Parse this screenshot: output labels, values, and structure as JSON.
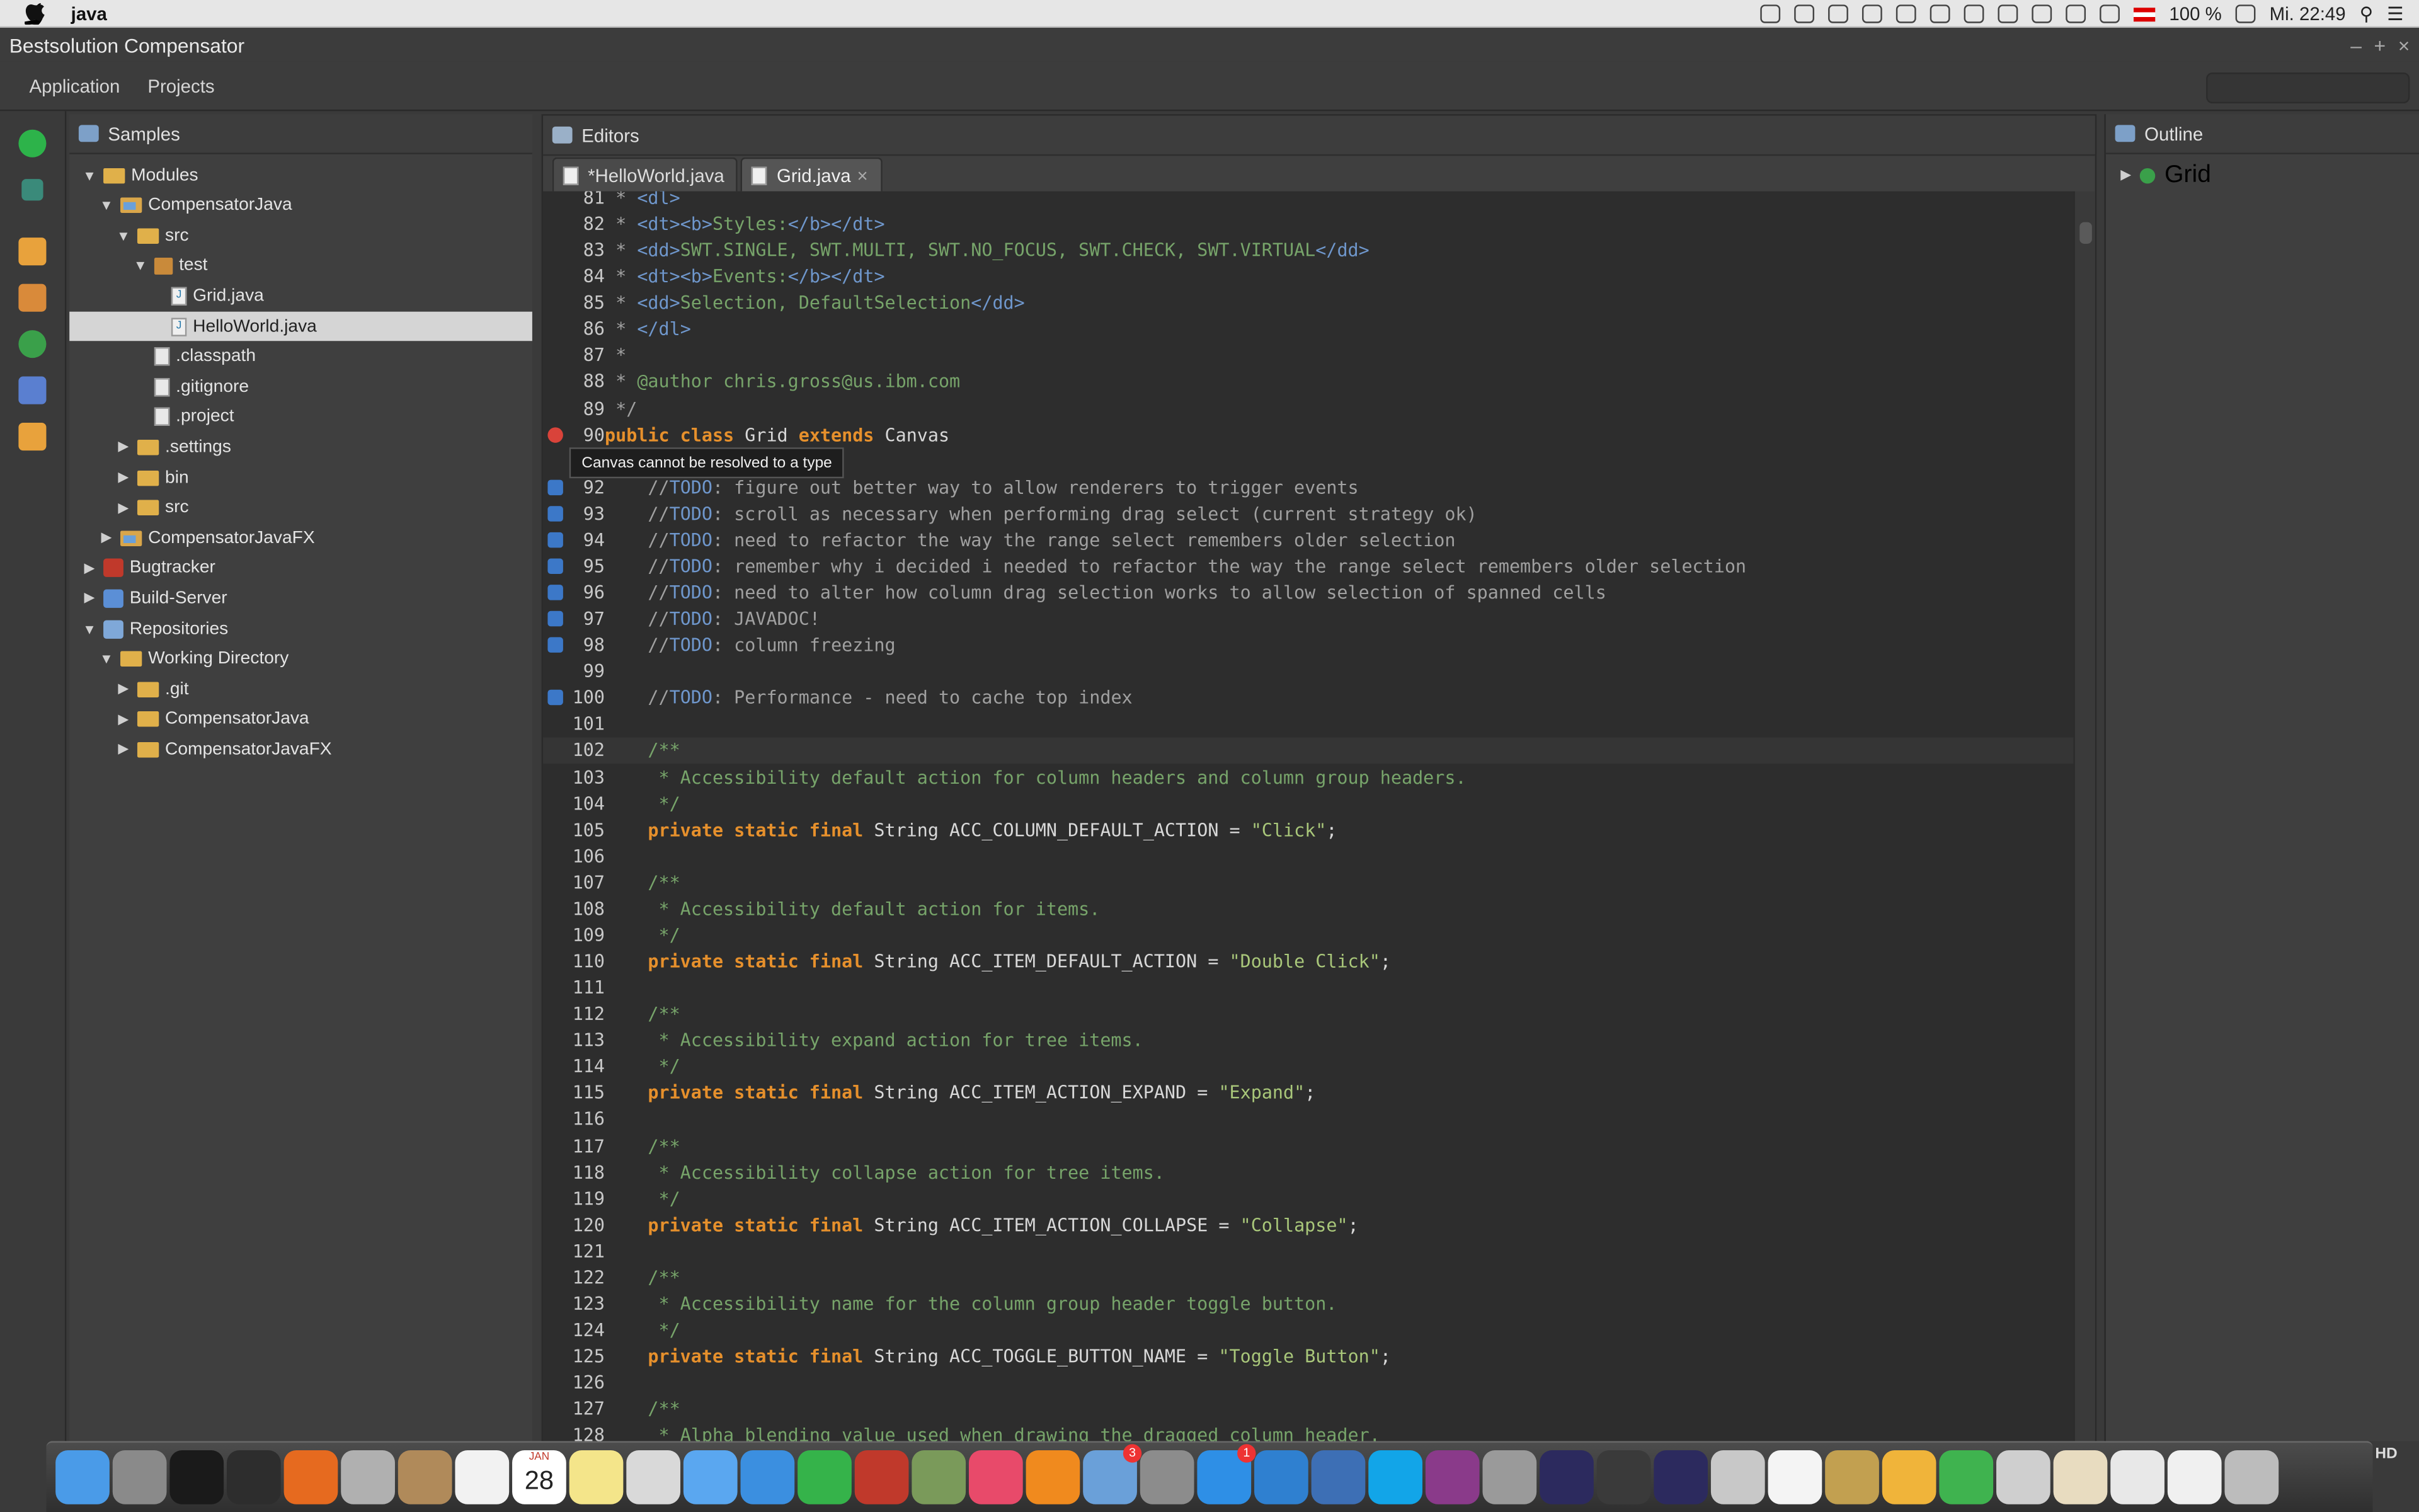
{
  "menubar": {
    "app_name": "java",
    "battery": "100 %",
    "clock": "Mi. 22:49"
  },
  "window": {
    "title": "Bestsolution Compensator",
    "controls": [
      "–",
      "+",
      "×"
    ]
  },
  "app_menu": {
    "items": [
      "Application",
      "Projects"
    ]
  },
  "left_panel": {
    "title": "Samples",
    "tree": [
      {
        "label": "Modules",
        "depth": 0,
        "expanded": true,
        "type": "folder"
      },
      {
        "label": "CompensatorJava",
        "depth": 1,
        "expanded": true,
        "type": "project"
      },
      {
        "label": "src",
        "depth": 2,
        "expanded": true,
        "type": "folder"
      },
      {
        "label": "test",
        "depth": 3,
        "expanded": true,
        "type": "package"
      },
      {
        "label": "Grid.java",
        "depth": 4,
        "type": "java"
      },
      {
        "label": "HelloWorld.java",
        "depth": 4,
        "type": "java",
        "selected": true
      },
      {
        "label": ".classpath",
        "depth": 3,
        "type": "file"
      },
      {
        "label": ".gitignore",
        "depth": 3,
        "type": "file"
      },
      {
        "label": ".project",
        "depth": 3,
        "type": "file"
      },
      {
        "label": ".settings",
        "depth": 2,
        "expanded": false,
        "type": "folder"
      },
      {
        "label": "bin",
        "depth": 2,
        "expanded": false,
        "type": "folder"
      },
      {
        "label": "src",
        "depth": 2,
        "expanded": false,
        "type": "folder"
      },
      {
        "label": "CompensatorJavaFX",
        "depth": 1,
        "expanded": false,
        "type": "project"
      },
      {
        "label": "Bugtracker",
        "depth": 0,
        "expanded": false,
        "type": "bug"
      },
      {
        "label": "Build-Server",
        "depth": 0,
        "expanded": false,
        "type": "build"
      },
      {
        "label": "Repositories",
        "depth": 0,
        "expanded": true,
        "type": "repo"
      },
      {
        "label": "Working Directory",
        "depth": 1,
        "expanded": true,
        "type": "folder"
      },
      {
        "label": ".git",
        "depth": 2,
        "expanded": false,
        "type": "folder"
      },
      {
        "label": "CompensatorJava",
        "depth": 2,
        "expanded": false,
        "type": "folder"
      },
      {
        "label": "CompensatorJavaFX",
        "depth": 2,
        "expanded": false,
        "type": "folder"
      }
    ]
  },
  "editors": {
    "title": "Editors",
    "tabs": [
      {
        "label": "*HelloWorld.java",
        "active": false
      },
      {
        "label": "Grid.java",
        "active": true,
        "close": "×"
      }
    ],
    "tooltip": "Canvas cannot be resolved to a type",
    "lines": [
      {
        "n": "81",
        "parts": [
          [
            "cg",
            " * "
          ],
          [
            "tg",
            "<dl>"
          ]
        ]
      },
      {
        "n": "82",
        "parts": [
          [
            "cg",
            " * "
          ],
          [
            "tg",
            "<dt><b>"
          ],
          [
            "cm",
            "Styles:"
          ],
          [
            "tg",
            "</b></dt>"
          ]
        ]
      },
      {
        "n": "83",
        "parts": [
          [
            "cg",
            " * "
          ],
          [
            "tg",
            "<dd>"
          ],
          [
            "cm",
            "SWT.SINGLE, SWT.MULTI, SWT.NO_FOCUS, SWT.CHECK, SWT.VIRTUAL"
          ],
          [
            "tg",
            "</dd>"
          ]
        ]
      },
      {
        "n": "84",
        "parts": [
          [
            "cg",
            " * "
          ],
          [
            "tg",
            "<dt><b>"
          ],
          [
            "cm",
            "Events:"
          ],
          [
            "tg",
            "</b></dt>"
          ]
        ]
      },
      {
        "n": "85",
        "parts": [
          [
            "cg",
            " * "
          ],
          [
            "tg",
            "<dd>"
          ],
          [
            "cm",
            "Selection, DefaultSelection"
          ],
          [
            "tg",
            "</dd>"
          ]
        ]
      },
      {
        "n": "86",
        "parts": [
          [
            "cg",
            " * "
          ],
          [
            "tg",
            "</dl>"
          ]
        ]
      },
      {
        "n": "87",
        "parts": [
          [
            "cg",
            " *"
          ]
        ]
      },
      {
        "n": "88",
        "parts": [
          [
            "cg",
            " * "
          ],
          [
            "cm",
            "@author chris.gross@us.ibm.com"
          ]
        ]
      },
      {
        "n": "89",
        "parts": [
          [
            "cg",
            " */"
          ]
        ]
      },
      {
        "n": "90",
        "marker": "err",
        "parts": [
          [
            "kw",
            "public class "
          ],
          [
            "",
            "Grid "
          ],
          [
            "kw",
            "extends "
          ],
          [
            "",
            "Canvas"
          ]
        ]
      },
      {
        "n": "91",
        "parts": []
      },
      {
        "n": "92",
        "marker": "task",
        "parts": [
          [
            "cg",
            "    //"
          ],
          [
            "tg",
            "TODO"
          ],
          [
            "cg",
            ": figure out better way to allow renderers to trigger events"
          ]
        ]
      },
      {
        "n": "93",
        "marker": "task",
        "parts": [
          [
            "cg",
            "    //"
          ],
          [
            "tg",
            "TODO"
          ],
          [
            "cg",
            ": scroll as necessary when performing drag select (current strategy ok)"
          ]
        ]
      },
      {
        "n": "94",
        "marker": "task",
        "parts": [
          [
            "cg",
            "    //"
          ],
          [
            "tg",
            "TODO"
          ],
          [
            "cg",
            ": need to refactor the way the range select remembers older selection"
          ]
        ]
      },
      {
        "n": "95",
        "marker": "task",
        "parts": [
          [
            "cg",
            "    //"
          ],
          [
            "tg",
            "TODO"
          ],
          [
            "cg",
            ": remember why i decided i needed to refactor the way the range select remembers older selection"
          ]
        ]
      },
      {
        "n": "96",
        "marker": "task",
        "parts": [
          [
            "cg",
            "    //"
          ],
          [
            "tg",
            "TODO"
          ],
          [
            "cg",
            ": need to alter how column drag selection works to allow selection of spanned cells"
          ]
        ]
      },
      {
        "n": "97",
        "marker": "task",
        "parts": [
          [
            "cg",
            "    //"
          ],
          [
            "tg",
            "TODO"
          ],
          [
            "cg",
            ": JAVADOC!"
          ]
        ]
      },
      {
        "n": "98",
        "marker": "task",
        "parts": [
          [
            "cg",
            "    //"
          ],
          [
            "tg",
            "TODO"
          ],
          [
            "cg",
            ": column freezing"
          ]
        ]
      },
      {
        "n": "99",
        "parts": []
      },
      {
        "n": "100",
        "marker": "task",
        "parts": [
          [
            "cg",
            "    //"
          ],
          [
            "tg",
            "TODO"
          ],
          [
            "cg",
            ": Performance - need to cache top index"
          ]
        ]
      },
      {
        "n": "101",
        "parts": []
      },
      {
        "n": "102",
        "current": true,
        "parts": [
          [
            "cm",
            "    /**"
          ]
        ]
      },
      {
        "n": "103",
        "parts": [
          [
            "cm",
            "     * Accessibility default action for column headers and column group headers."
          ]
        ]
      },
      {
        "n": "104",
        "parts": [
          [
            "cm",
            "     */"
          ]
        ]
      },
      {
        "n": "105",
        "parts": [
          [
            "kw",
            "    private static final "
          ],
          [
            "",
            "String ACC_COLUMN_DEFAULT_ACTION = "
          ],
          [
            "st",
            "\"Click\""
          ],
          [
            "",
            ";"
          ]
        ]
      },
      {
        "n": "106",
        "parts": []
      },
      {
        "n": "107",
        "parts": [
          [
            "cm",
            "    /**"
          ]
        ]
      },
      {
        "n": "108",
        "parts": [
          [
            "cm",
            "     * Accessibility default action for items."
          ]
        ]
      },
      {
        "n": "109",
        "parts": [
          [
            "cm",
            "     */"
          ]
        ]
      },
      {
        "n": "110",
        "parts": [
          [
            "kw",
            "    private static final "
          ],
          [
            "",
            "String ACC_ITEM_DEFAULT_ACTION = "
          ],
          [
            "st",
            "\"Double Click\""
          ],
          [
            "",
            ";"
          ]
        ]
      },
      {
        "n": "111",
        "parts": []
      },
      {
        "n": "112",
        "parts": [
          [
            "cm",
            "    /**"
          ]
        ]
      },
      {
        "n": "113",
        "parts": [
          [
            "cm",
            "     * Accessibility expand action for tree items."
          ]
        ]
      },
      {
        "n": "114",
        "parts": [
          [
            "cm",
            "     */"
          ]
        ]
      },
      {
        "n": "115",
        "parts": [
          [
            "kw",
            "    private static final "
          ],
          [
            "",
            "String ACC_ITEM_ACTION_EXPAND = "
          ],
          [
            "st",
            "\"Expand\""
          ],
          [
            "",
            ";"
          ]
        ]
      },
      {
        "n": "116",
        "parts": []
      },
      {
        "n": "117",
        "parts": [
          [
            "cm",
            "    /**"
          ]
        ]
      },
      {
        "n": "118",
        "parts": [
          [
            "cm",
            "     * Accessibility collapse action for tree items."
          ]
        ]
      },
      {
        "n": "119",
        "parts": [
          [
            "cm",
            "     */"
          ]
        ]
      },
      {
        "n": "120",
        "parts": [
          [
            "kw",
            "    private static final "
          ],
          [
            "",
            "String ACC_ITEM_ACTION_COLLAPSE = "
          ],
          [
            "st",
            "\"Collapse\""
          ],
          [
            "",
            ";"
          ]
        ]
      },
      {
        "n": "121",
        "parts": []
      },
      {
        "n": "122",
        "parts": [
          [
            "cm",
            "    /**"
          ]
        ]
      },
      {
        "n": "123",
        "parts": [
          [
            "cm",
            "     * Accessibility name for the column group header toggle button."
          ]
        ]
      },
      {
        "n": "124",
        "parts": [
          [
            "cm",
            "     */"
          ]
        ]
      },
      {
        "n": "125",
        "parts": [
          [
            "kw",
            "    private static final "
          ],
          [
            "",
            "String ACC_TOGGLE_BUTTON_NAME = "
          ],
          [
            "st",
            "\"Toggle Button\""
          ],
          [
            "",
            ";"
          ]
        ]
      },
      {
        "n": "126",
        "parts": []
      },
      {
        "n": "127",
        "parts": [
          [
            "cm",
            "    /**"
          ]
        ]
      },
      {
        "n": "128",
        "parts": [
          [
            "cm",
            "     * Alpha blending value used when drawing the dragged column header."
          ]
        ]
      }
    ]
  },
  "outline": {
    "title": "Outline",
    "items": [
      {
        "label": "Grid"
      }
    ]
  },
  "dock": {
    "apps": [
      {
        "name": "finder-icon",
        "color": "#4a9be8"
      },
      {
        "name": "launchpad-icon",
        "color": "#8a8a8a"
      },
      {
        "name": "terminal-icon",
        "color": "#1a1a1a"
      },
      {
        "name": "activity-monitor-icon",
        "color": "#2d2d2d"
      },
      {
        "name": "firefox-icon",
        "color": "#e66a1f"
      },
      {
        "name": "scissors-tool-icon",
        "color": "#b0b0b0"
      },
      {
        "name": "contacts-icon",
        "color": "#b08a5a"
      },
      {
        "name": "reminders-icon",
        "color": "#f2f2f2"
      },
      {
        "name": "calendar-icon",
        "color": "#ffffff",
        "label": "28",
        "sub": "JAN"
      },
      {
        "name": "notes-icon",
        "color": "#f4e58a"
      },
      {
        "name": "preview-icon",
        "color": "#d9d9d9"
      },
      {
        "name": "messages-icon",
        "color": "#5aa7f0"
      },
      {
        "name": "safari-icon",
        "color": "#3b8fe0"
      },
      {
        "name": "facetime-icon",
        "color": "#35b34a"
      },
      {
        "name": "photo-booth-icon",
        "color": "#c0392b"
      },
      {
        "name": "photos-icon",
        "color": "#7a9a5a"
      },
      {
        "name": "itunes-icon",
        "color": "#e84a6a"
      },
      {
        "name": "ibooks-icon",
        "color": "#f08a1e"
      },
      {
        "name": "mail-stamp-icon",
        "color": "#6aa0d9",
        "badge": "3"
      },
      {
        "name": "system-preferences-icon",
        "color": "#8c8c8c"
      },
      {
        "name": "app-store-icon",
        "color": "#2e8fe6",
        "badge": "1"
      },
      {
        "name": "lync-icon",
        "color": "#2f80d0"
      },
      {
        "name": "vmware-icon",
        "color": "#3d6fb5"
      },
      {
        "name": "skype-icon",
        "color": "#12a5e8"
      },
      {
        "name": "poser-icon",
        "color": "#8a3a8a"
      },
      {
        "name": "keychain-icon",
        "color": "#9a9a9a"
      },
      {
        "name": "eclipse-icon",
        "color": "#2c2a5e"
      },
      {
        "name": "xcode-icon",
        "color": "#3a3a3a"
      },
      {
        "name": "eclipse-luna-icon",
        "color": "#2c2a5e"
      },
      {
        "name": "image-capture-icon",
        "color": "#c8c8c8"
      },
      {
        "name": "document-icon",
        "color": "#f4f4f4"
      },
      {
        "name": "keys-icon",
        "color": "#c2a050"
      },
      {
        "name": "cloud-sync-icon",
        "color": "#f0b43a"
      },
      {
        "name": "mindmap-icon",
        "color": "#3fb34f"
      },
      {
        "name": "coffee-icon",
        "color": "#cfcfcf"
      },
      {
        "name": "certificate-icon",
        "color": "#e8dcc0"
      },
      {
        "name": "spreadsheet-icon",
        "color": "#e8e8e8"
      },
      {
        "name": "table-doc-icon",
        "color": "#f0f0f0"
      },
      {
        "name": "trash-icon",
        "color": "#bcbcbc"
      }
    ],
    "hd_label": "HD"
  }
}
